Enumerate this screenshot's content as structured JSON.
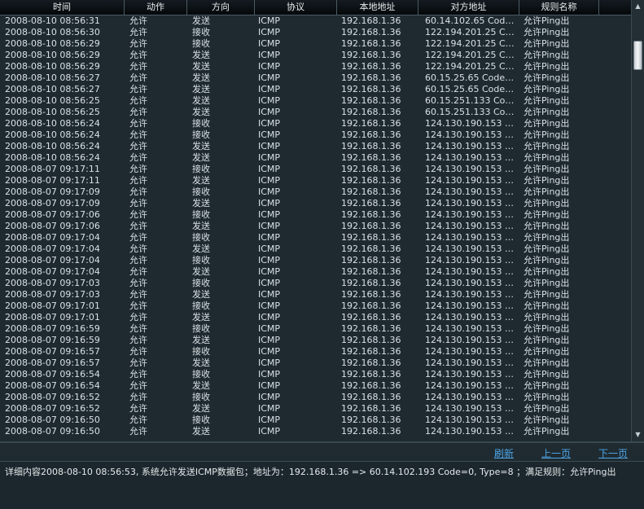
{
  "columns": [
    "时间",
    "动作",
    "方向",
    "协议",
    "本地地址",
    "对方地址",
    "规则名称"
  ],
  "rows": [
    [
      "2008-08-10 08:56:31",
      "允许",
      "发送",
      "ICMP",
      "192.168.1.36",
      "60.14.102.65 Code=...",
      "允许Ping出"
    ],
    [
      "2008-08-10 08:56:30",
      "允许",
      "接收",
      "ICMP",
      "192.168.1.36",
      "122.194.201.25 Cod...",
      "允许Ping出"
    ],
    [
      "2008-08-10 08:56:29",
      "允许",
      "接收",
      "ICMP",
      "192.168.1.36",
      "122.194.201.25 Cod...",
      "允许Ping出"
    ],
    [
      "2008-08-10 08:56:29",
      "允许",
      "发送",
      "ICMP",
      "192.168.1.36",
      "122.194.201.25 Cod...",
      "允许Ping出"
    ],
    [
      "2008-08-10 08:56:29",
      "允许",
      "发送",
      "ICMP",
      "192.168.1.36",
      "122.194.201.25 Cod...",
      "允许Ping出"
    ],
    [
      "2008-08-10 08:56:27",
      "允许",
      "发送",
      "ICMP",
      "192.168.1.36",
      "60.15.25.65 Code=0...",
      "允许Ping出"
    ],
    [
      "2008-08-10 08:56:27",
      "允许",
      "发送",
      "ICMP",
      "192.168.1.36",
      "60.15.25.65 Code=0...",
      "允许Ping出"
    ],
    [
      "2008-08-10 08:56:25",
      "允许",
      "发送",
      "ICMP",
      "192.168.1.36",
      "60.15.251.133 Code...",
      "允许Ping出"
    ],
    [
      "2008-08-10 08:56:25",
      "允许",
      "发送",
      "ICMP",
      "192.168.1.36",
      "60.15.251.133 Code...",
      "允许Ping出"
    ],
    [
      "2008-08-10 08:56:24",
      "允许",
      "接收",
      "ICMP",
      "192.168.1.36",
      "124.130.190.153 Cod...",
      "允许Ping出"
    ],
    [
      "2008-08-10 08:56:24",
      "允许",
      "接收",
      "ICMP",
      "192.168.1.36",
      "124.130.190.153 Cod...",
      "允许Ping出"
    ],
    [
      "2008-08-10 08:56:24",
      "允许",
      "发送",
      "ICMP",
      "192.168.1.36",
      "124.130.190.153 Cod...",
      "允许Ping出"
    ],
    [
      "2008-08-10 08:56:24",
      "允许",
      "发送",
      "ICMP",
      "192.168.1.36",
      "124.130.190.153 Cod...",
      "允许Ping出"
    ],
    [
      "2008-08-07 09:17:11",
      "允许",
      "接收",
      "ICMP",
      "192.168.1.36",
      "124.130.190.153 Cod...",
      "允许Ping出"
    ],
    [
      "2008-08-07 09:17:11",
      "允许",
      "发送",
      "ICMP",
      "192.168.1.36",
      "124.130.190.153 Cod...",
      "允许Ping出"
    ],
    [
      "2008-08-07 09:17:09",
      "允许",
      "接收",
      "ICMP",
      "192.168.1.36",
      "124.130.190.153 Cod...",
      "允许Ping出"
    ],
    [
      "2008-08-07 09:17:09",
      "允许",
      "发送",
      "ICMP",
      "192.168.1.36",
      "124.130.190.153 Cod...",
      "允许Ping出"
    ],
    [
      "2008-08-07 09:17:06",
      "允许",
      "接收",
      "ICMP",
      "192.168.1.36",
      "124.130.190.153 Cod...",
      "允许Ping出"
    ],
    [
      "2008-08-07 09:17:06",
      "允许",
      "发送",
      "ICMP",
      "192.168.1.36",
      "124.130.190.153 Cod...",
      "允许Ping出"
    ],
    [
      "2008-08-07 09:17:04",
      "允许",
      "接收",
      "ICMP",
      "192.168.1.36",
      "124.130.190.153 Cod...",
      "允许Ping出"
    ],
    [
      "2008-08-07 09:17:04",
      "允许",
      "发送",
      "ICMP",
      "192.168.1.36",
      "124.130.190.153 Cod...",
      "允许Ping出"
    ],
    [
      "2008-08-07 09:17:04",
      "允许",
      "接收",
      "ICMP",
      "192.168.1.36",
      "124.130.190.153 Cod...",
      "允许Ping出"
    ],
    [
      "2008-08-07 09:17:04",
      "允许",
      "发送",
      "ICMP",
      "192.168.1.36",
      "124.130.190.153 Cod...",
      "允许Ping出"
    ],
    [
      "2008-08-07 09:17:03",
      "允许",
      "接收",
      "ICMP",
      "192.168.1.36",
      "124.130.190.153 Cod...",
      "允许Ping出"
    ],
    [
      "2008-08-07 09:17:03",
      "允许",
      "发送",
      "ICMP",
      "192.168.1.36",
      "124.130.190.153 Cod...",
      "允许Ping出"
    ],
    [
      "2008-08-07 09:17:01",
      "允许",
      "接收",
      "ICMP",
      "192.168.1.36",
      "124.130.190.153 Cod...",
      "允许Ping出"
    ],
    [
      "2008-08-07 09:17:01",
      "允许",
      "发送",
      "ICMP",
      "192.168.1.36",
      "124.130.190.153 Cod...",
      "允许Ping出"
    ],
    [
      "2008-08-07 09:16:59",
      "允许",
      "接收",
      "ICMP",
      "192.168.1.36",
      "124.130.190.153 Cod...",
      "允许Ping出"
    ],
    [
      "2008-08-07 09:16:59",
      "允许",
      "发送",
      "ICMP",
      "192.168.1.36",
      "124.130.190.153 Cod...",
      "允许Ping出"
    ],
    [
      "2008-08-07 09:16:57",
      "允许",
      "接收",
      "ICMP",
      "192.168.1.36",
      "124.130.190.153 Cod...",
      "允许Ping出"
    ],
    [
      "2008-08-07 09:16:57",
      "允许",
      "发送",
      "ICMP",
      "192.168.1.36",
      "124.130.190.153 Cod...",
      "允许Ping出"
    ],
    [
      "2008-08-07 09:16:54",
      "允许",
      "接收",
      "ICMP",
      "192.168.1.36",
      "124.130.190.153 Cod...",
      "允许Ping出"
    ],
    [
      "2008-08-07 09:16:54",
      "允许",
      "发送",
      "ICMP",
      "192.168.1.36",
      "124.130.190.153 Cod...",
      "允许Ping出"
    ],
    [
      "2008-08-07 09:16:52",
      "允许",
      "接收",
      "ICMP",
      "192.168.1.36",
      "124.130.190.153 Cod...",
      "允许Ping出"
    ],
    [
      "2008-08-07 09:16:52",
      "允许",
      "发送",
      "ICMP",
      "192.168.1.36",
      "124.130.190.153 Cod...",
      "允许Ping出"
    ],
    [
      "2008-08-07 09:16:50",
      "允许",
      "接收",
      "ICMP",
      "192.168.1.36",
      "124.130.190.153 Cod...",
      "允许Ping出"
    ],
    [
      "2008-08-07 09:16:50",
      "允许",
      "发送",
      "ICMP",
      "192.168.1.36",
      "124.130.190.153 Cod...",
      "允许Ping出"
    ]
  ],
  "pager": {
    "refresh": "刷新",
    "prev": "上一页",
    "next": "下一页"
  },
  "detail": "详细内容2008-08-10 08:56:53, 系统允许发送ICMP数据包；地址为：192.168.1.36 => 60.14.102.193 Code=0, Type=8 ；满足规则：允许Ping出",
  "icons": {
    "scroll_up": "scroll-up-arrow-icon",
    "scroll_down": "scroll-down-arrow-icon"
  },
  "colors": {
    "background": "#1e2a30",
    "link": "#4ea4e6",
    "text": "#d9e0e4"
  }
}
